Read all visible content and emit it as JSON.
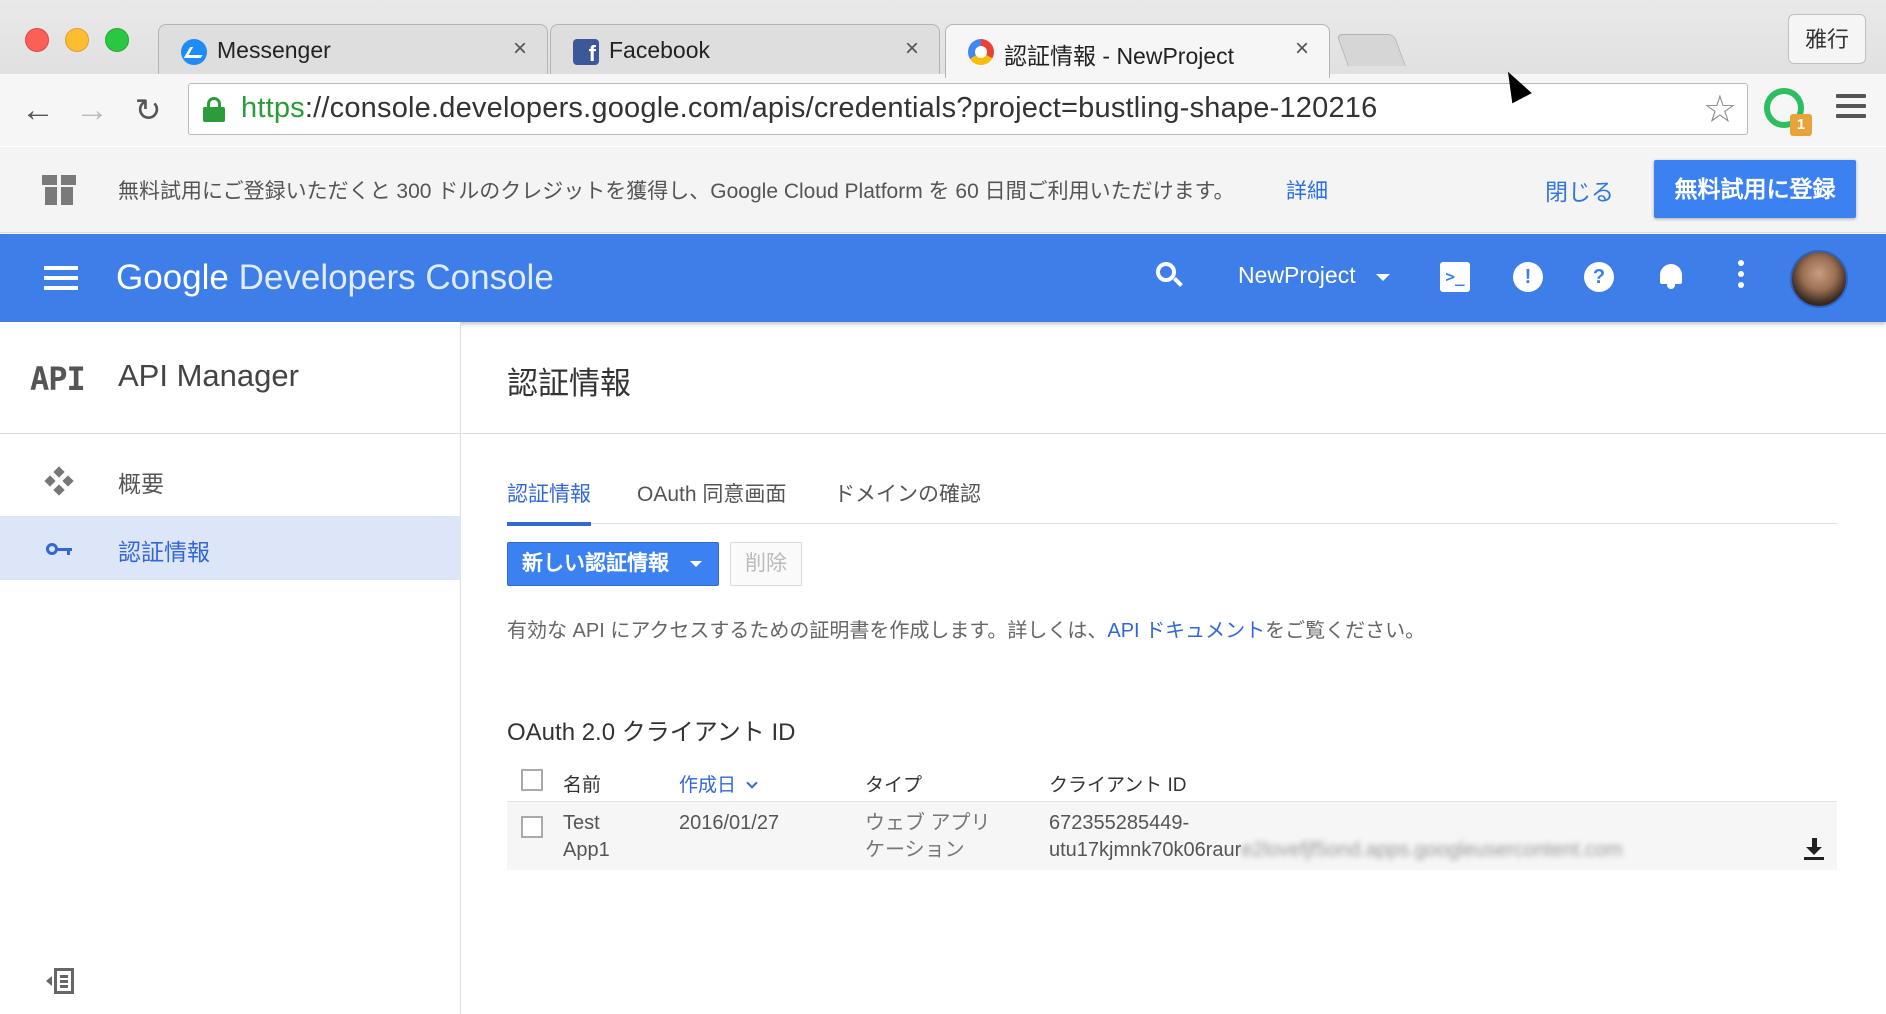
{
  "browser": {
    "tabs": [
      {
        "label": "Messenger",
        "icon": "messenger-icon"
      },
      {
        "label": "Facebook",
        "icon": "facebook-icon",
        "icon_glyph": "f"
      },
      {
        "label": "認証情報 - NewProject",
        "icon": "google-developers-icon",
        "active": true
      }
    ],
    "close_glyph": "×",
    "profile_button": "雅行",
    "url_scheme": "https",
    "url_rest": "://console.developers.google.com/apis/credentials?project=bustling-shape-120216",
    "nav": {
      "back": "←",
      "forward": "→",
      "reload": "↻"
    },
    "bookmark_star": "☆",
    "extension_badge": "1"
  },
  "banner": {
    "text": "無料試用にご登録いただくと 300 ドルのクレジットを獲得し、Google Cloud Platform を 60 日間ご利用いただけます。",
    "link": "詳細",
    "close": "閉じる",
    "signup": "無料試用に登録"
  },
  "appbar": {
    "brand_google": "Google",
    "brand_product": "Developers Console",
    "project": "NewProject",
    "shell_glyph": ">_",
    "feedback_glyph": "!",
    "help_glyph": "?"
  },
  "sidebar": {
    "logo": "API",
    "title": "API Manager",
    "items": [
      {
        "label": "概要",
        "icon": "dashboard-icon"
      },
      {
        "label": "認証情報",
        "icon": "key-icon",
        "active": true
      }
    ]
  },
  "main": {
    "title": "認証情報",
    "tabs": [
      {
        "label": "認証情報",
        "active": true
      },
      {
        "label": "OAuth 同意画面"
      },
      {
        "label": "ドメインの確認"
      }
    ],
    "new_credentials_button": "新しい認証情報",
    "delete_button": "削除",
    "description_prefix": "有効な API にアクセスするための証明書を作成します。詳しくは、",
    "description_link": "API ドキュメント",
    "description_suffix": "をご覧ください。",
    "section_title": "OAuth 2.0 クライアント ID",
    "table": {
      "headers": {
        "name": "名前",
        "created": "作成日",
        "type": "タイプ",
        "client_id": "クライアント ID"
      },
      "rows": [
        {
          "name_line1": "Test",
          "name_line2": "App1",
          "created": "2016/01/27",
          "type_line1": "ウェブ アプリ",
          "type_line2": "ケーション",
          "client_id_line1": "672355285449-",
          "client_id_line2": "utu17kjmnk70k06raur",
          "client_id_obscured": "e2lovefjf5ond.apps.googleusercontent.com"
        }
      ]
    }
  }
}
